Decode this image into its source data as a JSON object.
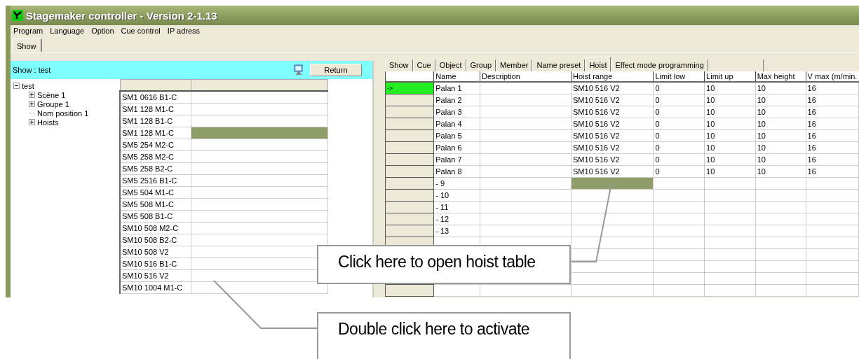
{
  "window": {
    "title": "Stagemaker controller - Version 2-1.13"
  },
  "menu": [
    "Program",
    "Language",
    "Option",
    "Cue control",
    "IP adress"
  ],
  "main_tabs": [
    {
      "label": "Show",
      "selected": true
    }
  ],
  "show_panel": {
    "title": "Show : test",
    "return_button": "Return",
    "tree": [
      {
        "label": "test",
        "expandable": true,
        "expanded": true,
        "children": [
          {
            "label": "Scène 1",
            "expandable": true,
            "expanded": false
          },
          {
            "label": "Groupe 1",
            "expandable": true,
            "expanded": false
          },
          {
            "label": "Nom position 1",
            "expandable": false
          },
          {
            "label": "Hoists",
            "expandable": true,
            "expanded": false
          }
        ]
      }
    ],
    "hoist_types": [
      {
        "name": "SM1 0616 B1-C",
        "selected": false
      },
      {
        "name": "SM1 128 M1-C",
        "selected": false
      },
      {
        "name": "SM1 128 B1-C",
        "selected": false
      },
      {
        "name": "SM1 128 M1-C",
        "selected": true
      },
      {
        "name": "SM5 254 M2-C",
        "selected": false
      },
      {
        "name": "SM5 258 M2-C",
        "selected": false
      },
      {
        "name": "SM5 258 B2-C",
        "selected": false
      },
      {
        "name": "SM5 2516 B1-C",
        "selected": false
      },
      {
        "name": "SM5 504 M1-C",
        "selected": false
      },
      {
        "name": "SM5 508 M1-C",
        "selected": false
      },
      {
        "name": "SM5 508 B1-C",
        "selected": false
      },
      {
        "name": "SM10 508 M2-C",
        "selected": false
      },
      {
        "name": "SM10 508 B2-C",
        "selected": false
      },
      {
        "name": "SM10 508 V2",
        "selected": false
      },
      {
        "name": "SM10 516 B1-C",
        "selected": false
      },
      {
        "name": "SM10 516 V2",
        "selected": false
      },
      {
        "name": "SM10 1004 M1-C",
        "selected": false
      }
    ]
  },
  "hoist_tabs": [
    {
      "label": "Show",
      "selected": false
    },
    {
      "label": "Cue",
      "selected": false
    },
    {
      "label": "Object",
      "selected": false
    },
    {
      "label": "Group",
      "selected": false
    },
    {
      "label": "Member",
      "selected": false
    },
    {
      "label": "Name preset",
      "selected": false
    },
    {
      "label": "Hoist",
      "selected": true
    },
    {
      "label": "Effect mode programming",
      "selected": false
    }
  ],
  "hoist_table": {
    "current_row_marker": "->",
    "columns": [
      "Name",
      "Description",
      "Hoist range",
      "Limit low",
      "Limit up",
      "Max height",
      "V max (m/min."
    ],
    "rows": [
      {
        "selected": true,
        "range_selected": false,
        "cells": [
          "Palan 1",
          "",
          "SM10 516 V2",
          "0",
          "10",
          "10",
          "16"
        ]
      },
      {
        "selected": false,
        "range_selected": false,
        "cells": [
          "Palan 2",
          "",
          "SM10 516 V2",
          "0",
          "10",
          "10",
          "16"
        ]
      },
      {
        "selected": false,
        "range_selected": false,
        "cells": [
          "Palan 3",
          "",
          "SM10 516 V2",
          "0",
          "10",
          "10",
          "16"
        ]
      },
      {
        "selected": false,
        "range_selected": false,
        "cells": [
          "Palan 4",
          "",
          "SM10 516 V2",
          "0",
          "10",
          "10",
          "16"
        ]
      },
      {
        "selected": false,
        "range_selected": false,
        "cells": [
          "Palan 5",
          "",
          "SM10 516 V2",
          "0",
          "10",
          "10",
          "16"
        ]
      },
      {
        "selected": false,
        "range_selected": false,
        "cells": [
          "Palan 6",
          "",
          "SM10 516 V2",
          "0",
          "10",
          "10",
          "16"
        ]
      },
      {
        "selected": false,
        "range_selected": false,
        "cells": [
          "Palan 7",
          "",
          "SM10 516 V2",
          "0",
          "10",
          "10",
          "16"
        ]
      },
      {
        "selected": false,
        "range_selected": false,
        "cells": [
          "Palan 8",
          "",
          "SM10 516 V2",
          "0",
          "10",
          "10",
          "16"
        ]
      },
      {
        "selected": false,
        "range_selected": true,
        "cells": [
          "- 9",
          "",
          "",
          "",
          "",
          "",
          ""
        ]
      },
      {
        "selected": false,
        "range_selected": false,
        "cells": [
          "- 10",
          "",
          "",
          "",
          "",
          "",
          ""
        ]
      },
      {
        "selected": false,
        "range_selected": false,
        "cells": [
          "- 11",
          "",
          "",
          "",
          "",
          "",
          ""
        ]
      },
      {
        "selected": false,
        "range_selected": false,
        "cells": [
          "- 12",
          "",
          "",
          "",
          "",
          "",
          ""
        ]
      },
      {
        "selected": false,
        "range_selected": false,
        "cells": [
          "- 13",
          "",
          "",
          "",
          "",
          "",
          ""
        ]
      }
    ]
  },
  "callouts": [
    {
      "text": "Click here to open hoist table"
    },
    {
      "text": "Double click here to activate"
    }
  ]
}
